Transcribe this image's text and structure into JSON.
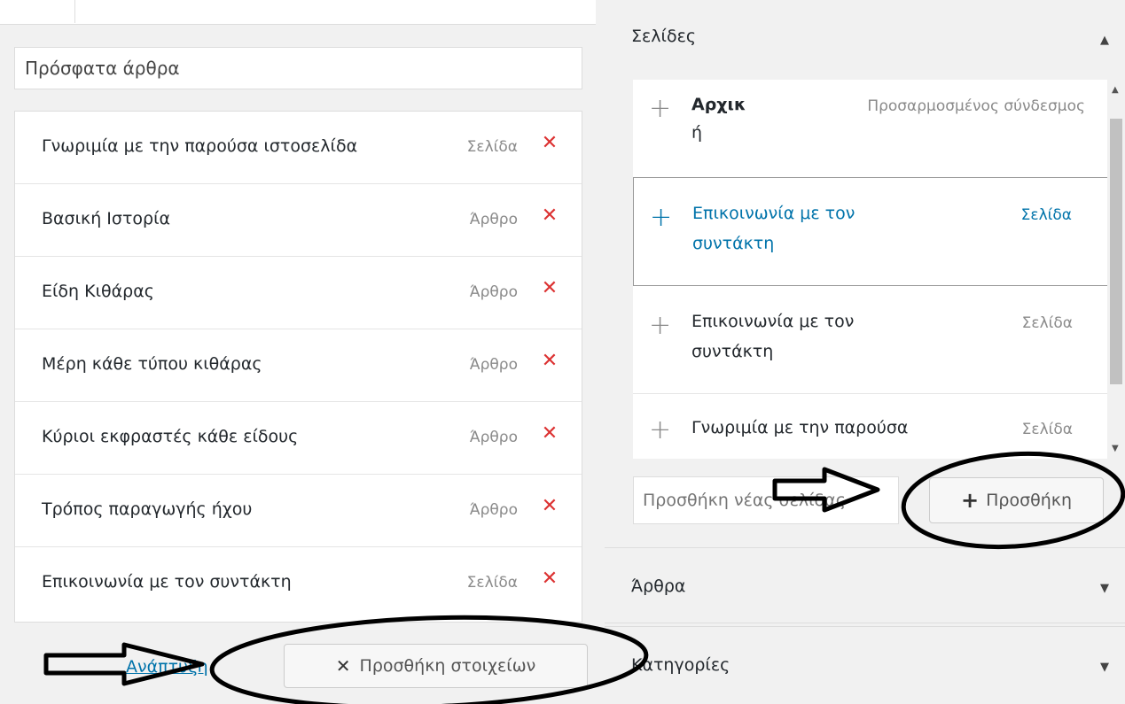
{
  "menu": {
    "name_value": "Πρόσφατα άρθρα",
    "items": [
      {
        "title": "Γνωριμία με την παρούσα ιστοσελίδα",
        "type": "Σελίδα"
      },
      {
        "title": "Βασική Ιστορία",
        "type": "Άρθρο"
      },
      {
        "title": "Είδη Κιθάρας",
        "type": "Άρθρο"
      },
      {
        "title": "Μέρη κάθε τύπου κιθάρας",
        "type": "Άρθρο"
      },
      {
        "title": "Κύριοι εκφραστές κάθε είδους",
        "type": "Άρθρο"
      },
      {
        "title": "Τρόπος παραγωγής ήχου",
        "type": "Άρθρο"
      },
      {
        "title": "Επικοινωνία με τον συντάκτη",
        "type": "Σελίδα"
      }
    ],
    "delete_icon": "✕",
    "expand_link": "Ανάπτυξη",
    "add_items_button": "Προσθήκη στοιχείων",
    "add_items_icon": "✕"
  },
  "pages": {
    "title": "Σελίδες",
    "collapse_icon": "▲",
    "rows": [
      {
        "title_line1": "Αρχικ",
        "title_line2": "ή",
        "type": "Προσαρμοσμένος σύνδεσμος"
      },
      {
        "title_line1": "Επικοινωνία με τον",
        "title_line2": "συντάκτη",
        "type": "Σελίδα"
      },
      {
        "title_line1": "Επικοινωνία με τον",
        "title_line2": "συντάκτη",
        "type": "Σελίδα"
      },
      {
        "title_line1": "Γνωριμία με την παρούσα",
        "title_line2": "",
        "type": "Σελίδα"
      }
    ],
    "plus_icon": "+",
    "new_page_placeholder": "Προσθήκη νέας σελίδας",
    "add_button": "Προσθήκη",
    "add_icon": "+"
  },
  "articles": {
    "title": "Άρθρα",
    "expand_icon": "▼"
  },
  "categories": {
    "title": "Κατηγορίες",
    "expand_icon": "▼"
  }
}
